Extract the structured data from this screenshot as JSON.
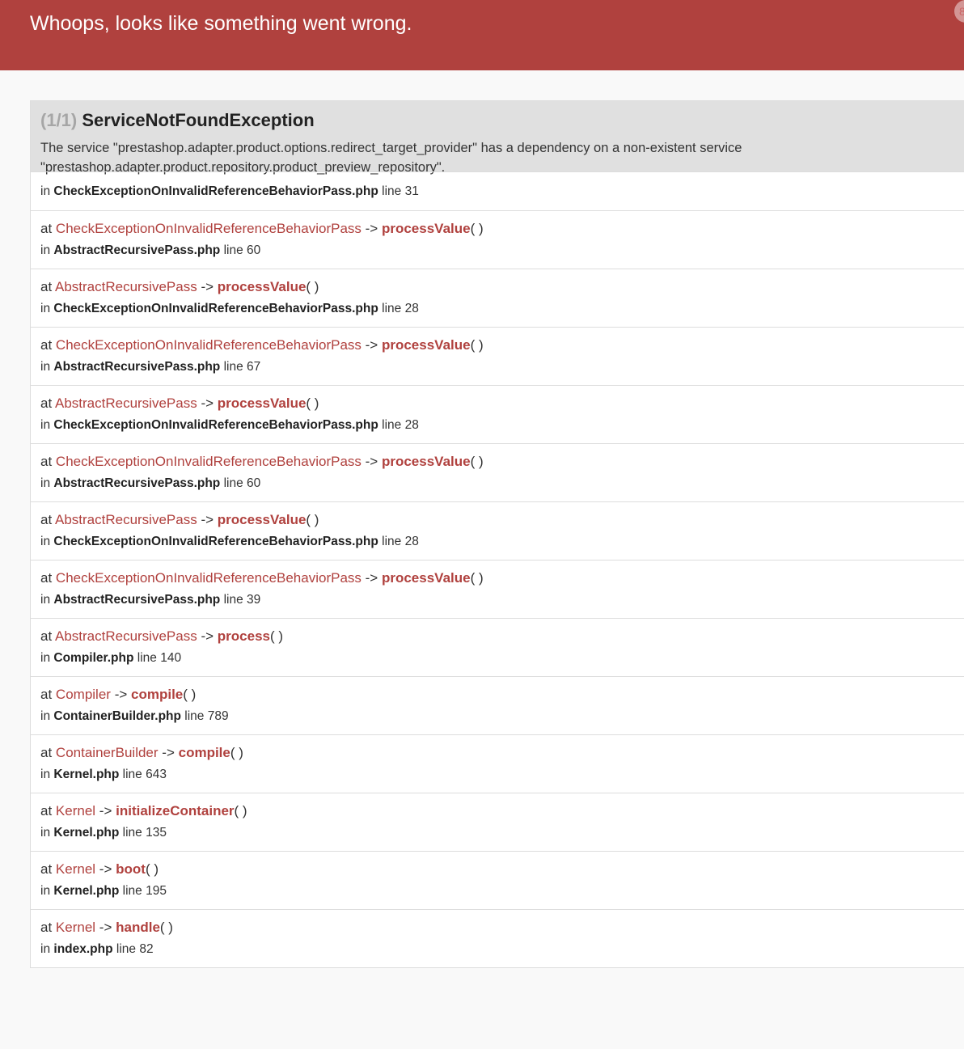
{
  "header": {
    "title": "Whoops, looks like something went wrong.",
    "corner_icon": "circle-badge-icon"
  },
  "exception": {
    "count": "(1/1)",
    "name": "ServiceNotFoundException",
    "message": "The service \"prestashop.adapter.product.options.redirect_target_provider\" has a dependency on a non-existent service \"prestashop.adapter.product.repository.product_preview_repository\"."
  },
  "labels": {
    "in": "in",
    "at": "at",
    "line": "line",
    "arrow": "->",
    "parens": "( )"
  },
  "first_frame": {
    "file": "CheckExceptionOnInvalidReferenceBehaviorPass.php",
    "line": "31"
  },
  "frames": [
    {
      "class": "CheckExceptionOnInvalidReferenceBehaviorPass",
      "method": "processValue",
      "file": "AbstractRecursivePass.php",
      "line": "60"
    },
    {
      "class": "AbstractRecursivePass",
      "method": "processValue",
      "file": "CheckExceptionOnInvalidReferenceBehaviorPass.php",
      "line": "28"
    },
    {
      "class": "CheckExceptionOnInvalidReferenceBehaviorPass",
      "method": "processValue",
      "file": "AbstractRecursivePass.php",
      "line": "67"
    },
    {
      "class": "AbstractRecursivePass",
      "method": "processValue",
      "file": "CheckExceptionOnInvalidReferenceBehaviorPass.php",
      "line": "28"
    },
    {
      "class": "CheckExceptionOnInvalidReferenceBehaviorPass",
      "method": "processValue",
      "file": "AbstractRecursivePass.php",
      "line": "60"
    },
    {
      "class": "AbstractRecursivePass",
      "method": "processValue",
      "file": "CheckExceptionOnInvalidReferenceBehaviorPass.php",
      "line": "28"
    },
    {
      "class": "CheckExceptionOnInvalidReferenceBehaviorPass",
      "method": "processValue",
      "file": "AbstractRecursivePass.php",
      "line": "39"
    },
    {
      "class": "AbstractRecursivePass",
      "method": "process",
      "file": "Compiler.php",
      "line": "140"
    },
    {
      "class": "Compiler",
      "method": "compile",
      "file": "ContainerBuilder.php",
      "line": "789"
    },
    {
      "class": "ContainerBuilder",
      "method": "compile",
      "file": "Kernel.php",
      "line": "643"
    },
    {
      "class": "Kernel",
      "method": "initializeContainer",
      "file": "Kernel.php",
      "line": "135"
    },
    {
      "class": "Kernel",
      "method": "boot",
      "file": "Kernel.php",
      "line": "195"
    },
    {
      "class": "Kernel",
      "method": "handle",
      "file": "index.php",
      "line": "82"
    }
  ],
  "colors": {
    "header_bg": "#b0413e",
    "accent": "#b0413e",
    "block_header_bg": "#e0e0e0",
    "page_bg": "#f9f9f9"
  }
}
